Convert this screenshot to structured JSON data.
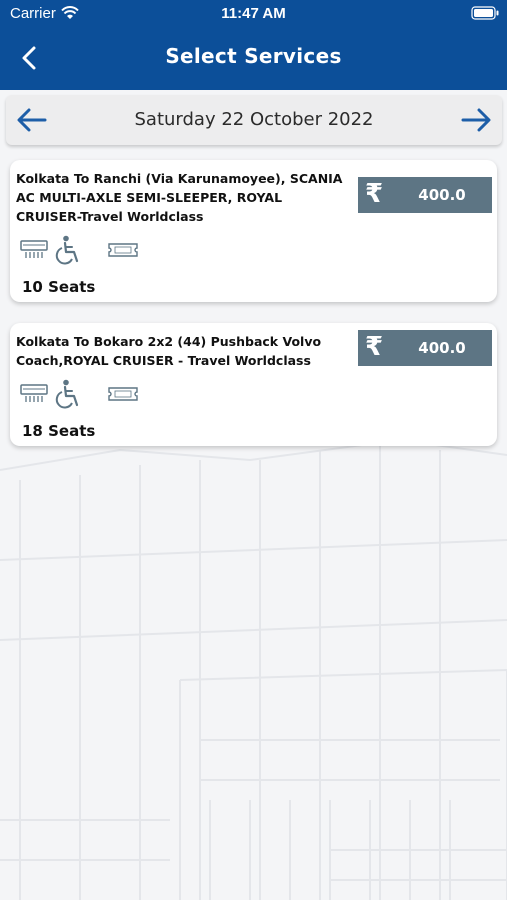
{
  "status_bar": {
    "carrier": "Carrier",
    "time": "11:47 AM"
  },
  "header": {
    "title": "Select Services"
  },
  "date_bar": {
    "date": "Saturday 22 October 2022"
  },
  "services": [
    {
      "route": "Kolkata To Ranchi (Via Karunamoyee), SCANIA AC MULTI-AXLE SEMI-SLEEPER, ROYAL CRUISER-Travel Worldclass",
      "currency_symbol": "₹",
      "fare": "400.0",
      "seats": "10 Seats",
      "amenities": [
        "ac-icon",
        "wheelchair-icon",
        "ticket-icon"
      ]
    },
    {
      "route": "Kolkata To Bokaro 2x2 (44) Pushback Volvo Coach,ROYAL CRUISER - Travel Worldclass",
      "currency_symbol": "₹",
      "fare": "400.0",
      "seats": "18 Seats",
      "amenities": [
        "ac-icon",
        "wheelchair-icon",
        "ticket-icon"
      ]
    }
  ],
  "colors": {
    "header": "#0c4f99",
    "fare_box": "#5d7584",
    "arrow": "#1d5ea8"
  }
}
